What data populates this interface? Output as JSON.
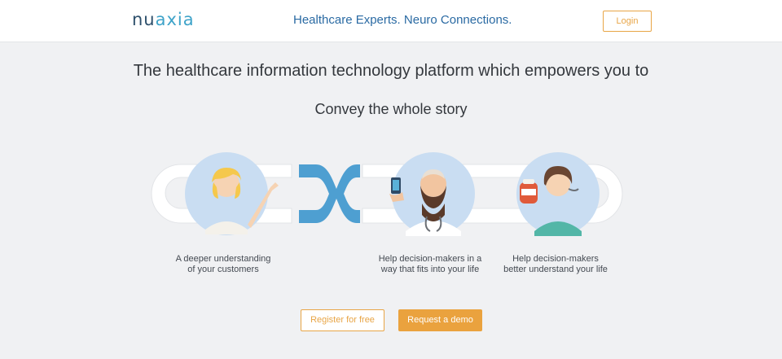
{
  "header": {
    "logo_text_a": "nu",
    "logo_text_b": "axia",
    "tagline": "Healthcare Experts. Neuro Connections.",
    "login_label": "Login"
  },
  "hero": {
    "headline": "The healthcare information technology platform which empowers you to",
    "subheadline": "Convey the whole story"
  },
  "features": [
    {
      "line1": "A deeper understanding",
      "line2": "of your customers"
    },
    {
      "line1": "Help decision-makers in a",
      "line2": "way that fits into your life"
    },
    {
      "line1": "Help decision-makers",
      "line2": "better understand your life"
    }
  ],
  "actions": {
    "register_label": "Register for free",
    "demo_label": "Request a demo"
  },
  "icons": [
    "businesswoman-illustration",
    "connector-logo-mark",
    "doctor-illustration",
    "nurse-illustration"
  ],
  "colors": {
    "accent_orange": "#e8a546",
    "brand_blue": "#2a6aa3",
    "connector_blue": "#4e9fd1",
    "circle_blue": "#c9ddf2"
  }
}
